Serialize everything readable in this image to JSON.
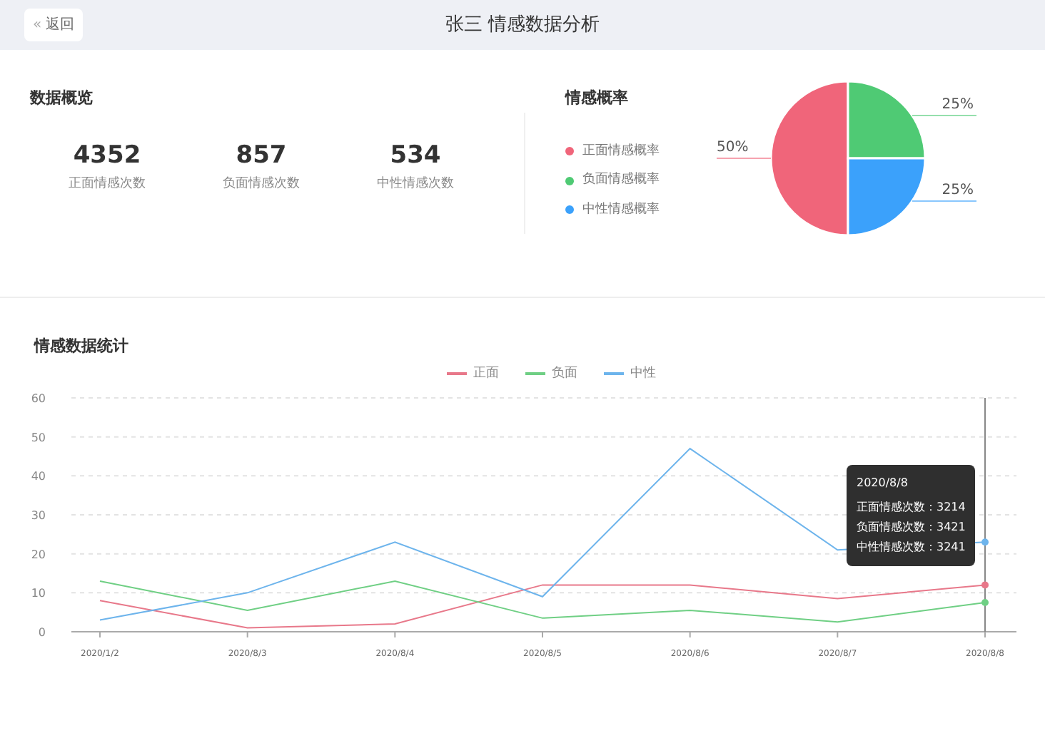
{
  "header": {
    "back_button": "返回",
    "back_icon": "«",
    "title": "张三 情感数据分析"
  },
  "overview": {
    "title": "数据概览",
    "stats": [
      {
        "value": "4352",
        "label": "正面情感次数"
      },
      {
        "value": "857",
        "label": "负面情感次数"
      },
      {
        "value": "534",
        "label": "中性情感次数"
      }
    ]
  },
  "probability": {
    "title": "情感概率",
    "chart_data": {
      "type": "pie",
      "categories": [
        "正面情感概率",
        "负面情感概率",
        "中性情感概率"
      ],
      "values": [
        50,
        25,
        25
      ],
      "colors": [
        "#f0657a",
        "#4fca74",
        "#3ba1fb"
      ],
      "data_labels": true,
      "value_labels": [
        "50%",
        "25%",
        "25%"
      ]
    }
  },
  "statistics": {
    "title": "情感数据统计",
    "chart_data": {
      "type": "line",
      "grid": true,
      "ref_lines": [
        {
          "axis": "x",
          "value": "2020/8/8",
          "color": "#888888"
        }
      ],
      "categories": [
        "2020/1/2",
        "2020/8/3",
        "2020/8/4",
        "2020/8/5",
        "2020/8/6",
        "2020/8/7",
        "2020/8/8"
      ],
      "ylim": [
        0,
        60
      ],
      "yticks": [
        0,
        10,
        20,
        30,
        40,
        50,
        60
      ],
      "series": [
        {
          "name": "正面",
          "color": "#e8788a",
          "values": [
            8,
            1,
            2,
            12,
            12,
            8.5,
            12
          ]
        },
        {
          "name": "负面",
          "color": "#6fcf84",
          "values": [
            13,
            5.5,
            13,
            3.5,
            5.5,
            2.5,
            7.5
          ]
        },
        {
          "name": "中性",
          "color": "#6db4ec",
          "values": [
            3,
            10,
            23,
            9,
            47,
            21,
            23
          ]
        }
      ]
    },
    "tooltip": {
      "title": "2020/8/8",
      "lines": [
        "正面情感次数：3214",
        "负面情感次数：3421",
        "中性情感次数：3241"
      ]
    }
  }
}
